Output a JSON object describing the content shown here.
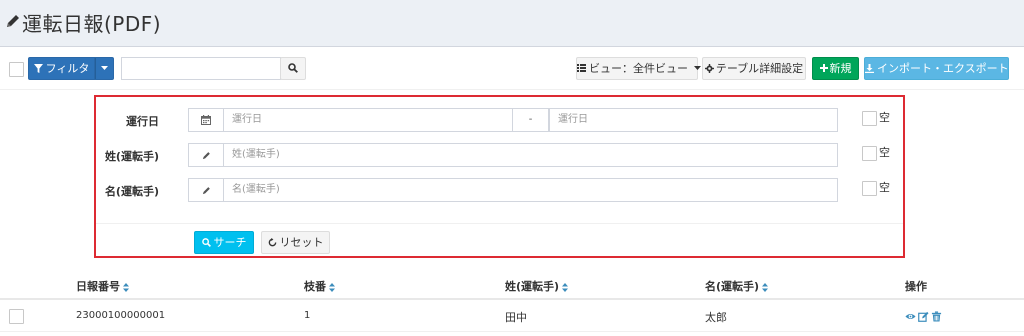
{
  "page": {
    "title": "運転日報(PDF)"
  },
  "toolbar": {
    "filter_label": "フィルタ",
    "search_placeholder": "",
    "view_label": "ビュー：全件ビュー",
    "table_settings_label": "テーブル詳細設定",
    "new_label": "新規",
    "import_export_label": "インポート・エクスポート"
  },
  "search_panel": {
    "rows": [
      {
        "label": "運行日",
        "placeholder_from": "運行日",
        "separator": "-",
        "placeholder_to": "運行日",
        "empty_label": "空"
      },
      {
        "label": "姓(運転手)",
        "placeholder": "姓(運転手)",
        "empty_label": "空"
      },
      {
        "label": "名(運転手)",
        "placeholder": "名(運転手)",
        "empty_label": "空"
      }
    ],
    "search_button": "サーチ",
    "reset_button": "リセット"
  },
  "table": {
    "columns": [
      "日報番号",
      "枝番",
      "姓(運転手)",
      "名(運転手)",
      "操作"
    ],
    "rows": [
      {
        "report_no": "23000100000001",
        "branch": "1",
        "last_name": "田中",
        "first_name": "太郎"
      }
    ]
  },
  "colors": {
    "primary": "#2d72b8",
    "success": "#00a65a",
    "info": "#5bb7e4",
    "search": "#00c0ef",
    "highlight_border": "#dd2a32",
    "action_icon": "#3c8dbc"
  },
  "icons": [
    "pencil-icon",
    "filter-icon",
    "caret-down-icon",
    "search-icon",
    "list-icon",
    "gear-icon",
    "plus-icon",
    "download-icon",
    "calendar-icon",
    "refresh-icon",
    "sort-icon",
    "eye-icon",
    "edit-icon",
    "trash-icon"
  ]
}
